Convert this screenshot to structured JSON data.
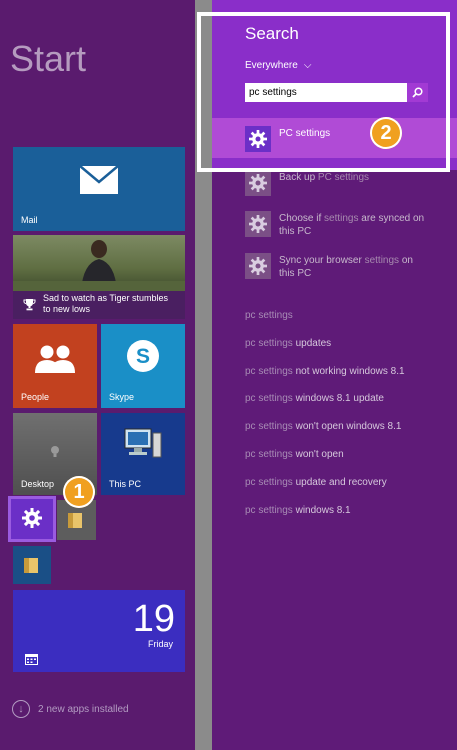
{
  "start": {
    "title": "Start",
    "tiles": {
      "mail": "Mail",
      "news_caption": "Sad to watch as Tiger stumbles to new lows",
      "people": "People",
      "skype": "Skype",
      "desktop": "Desktop",
      "thispc": "This PC",
      "calendar_day": "19",
      "calendar_weekday": "Friday"
    },
    "install_notice": "2 new apps installed"
  },
  "search": {
    "title": "Search",
    "scope": "Everywhere",
    "scope_arrow": "⌵",
    "query": "pc settings",
    "results": [
      {
        "label": "PC settings",
        "highlighted": true
      },
      {
        "before": "Back up ",
        "hit": "PC settings",
        "after": ""
      },
      {
        "before": "Choose if ",
        "hit": "settings",
        "after": " are synced on this PC"
      },
      {
        "before": "Sync your browser ",
        "hit": "settings",
        "after": " on this PC"
      }
    ],
    "suggestions": [
      {
        "prefix": "pc settings",
        "suffix": ""
      },
      {
        "prefix": "pc settings",
        "suffix": " updates"
      },
      {
        "prefix": "pc settings",
        "suffix": " not working windows 8.1"
      },
      {
        "prefix": "pc settings",
        "suffix": " windows 8.1 update"
      },
      {
        "prefix": "pc settings",
        "suffix": " won't open windows 8.1"
      },
      {
        "prefix": "pc settings",
        "suffix": " won't open"
      },
      {
        "prefix": "pc settings",
        "suffix": " update and recovery"
      },
      {
        "prefix": "pc settings",
        "suffix": " windows 8.1"
      }
    ]
  },
  "badges": [
    "1",
    "2"
  ],
  "colors": {
    "accent": "#8a2ec9",
    "badge": "#f0a020",
    "pane": "#5f1b78"
  }
}
